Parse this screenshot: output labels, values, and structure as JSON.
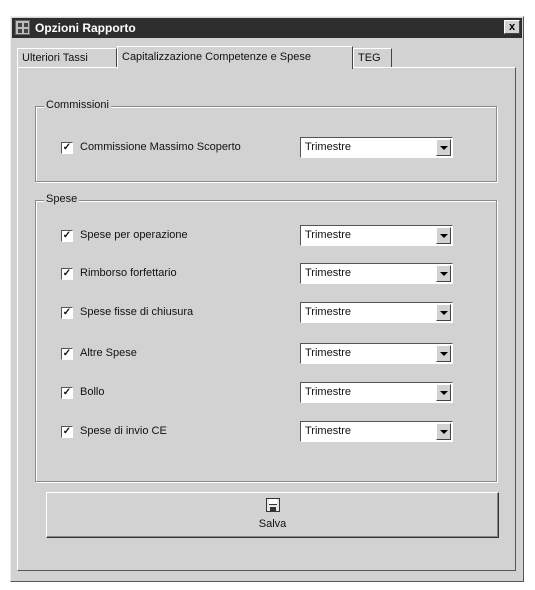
{
  "window": {
    "title": "Opzioni Rapporto",
    "close_label": "x"
  },
  "tabs": [
    {
      "label": "Ulteriori Tassi"
    },
    {
      "label": "Capitalizzazione Competenze e Spese"
    },
    {
      "label": "TEG"
    }
  ],
  "active_tab": 1,
  "commissions_group": {
    "title": "Commissioni",
    "rows": [
      {
        "label": "Commissione Massimo Scoperto",
        "checked": true,
        "value": "Trimestre"
      }
    ]
  },
  "expenses_group": {
    "title": "Spese",
    "rows": [
      {
        "label": "Spese per operazione",
        "checked": true,
        "value": "Trimestre"
      },
      {
        "label": "Rimborso forfettario",
        "checked": true,
        "value": "Trimestre"
      },
      {
        "label": "Spese fisse di chiusura",
        "checked": true,
        "value": "Trimestre"
      },
      {
        "label": "Altre Spese",
        "checked": true,
        "value": "Trimestre"
      },
      {
        "label": "Bollo",
        "checked": true,
        "value": "Trimestre"
      },
      {
        "label": "Spese di invio CE",
        "checked": true,
        "value": "Trimestre"
      }
    ]
  },
  "save_button": {
    "label": "Salva",
    "icon": "save-icon"
  },
  "colors": {
    "titlebar": "#2e2e2e",
    "face": "#d2d2d2"
  }
}
